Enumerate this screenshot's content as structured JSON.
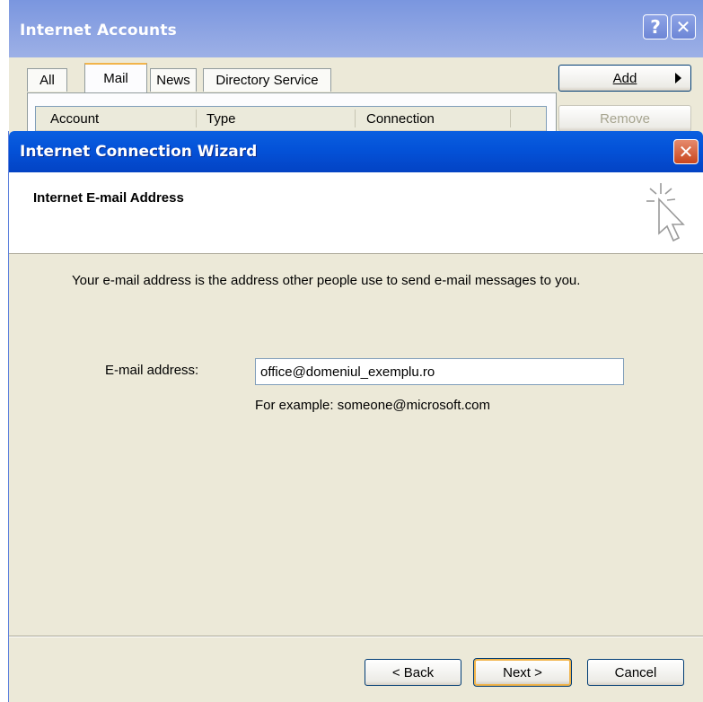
{
  "accounts_window": {
    "title": "Internet Accounts",
    "help_label": "?",
    "close_label": "✕",
    "tabs": [
      {
        "label": "All"
      },
      {
        "label": "Mail"
      },
      {
        "label": "News"
      },
      {
        "label": "Directory Service"
      }
    ],
    "columns": [
      "Account",
      "Type",
      "Connection"
    ],
    "add_label": "Add",
    "remove_label": "Remove"
  },
  "wizard": {
    "title": "Internet Connection Wizard",
    "close_label": "✕",
    "heading": "Internet E-mail Address",
    "description": "Your e-mail address is the address other people use to send e-mail messages to you.",
    "email_label": "E-mail address:",
    "email_value": "office@domeniul_exemplu.ro",
    "example_text": "For example: someone@microsoft.com",
    "back_label": "< Back",
    "next_label": "Next >",
    "cancel_label": "Cancel",
    "logo_icon": "cursor-sparkle-icon"
  },
  "colors": {
    "titlebar_active": "#0452d8",
    "titlebar_inactive": "#7a96df",
    "dialog_bg": "#ece9d8",
    "close_red": "#c8461e"
  }
}
